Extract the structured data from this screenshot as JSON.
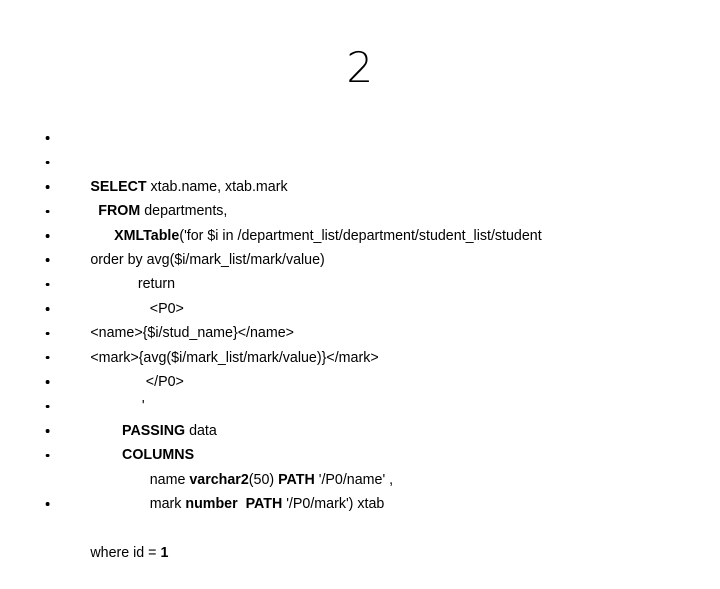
{
  "slide": {
    "title": "2",
    "background_color": "#ffffff",
    "text_color": "#000000",
    "bullet_glyph": "•"
  },
  "code_block": {
    "language": "Oracle SQL / XQuery",
    "lines": [
      {
        "text": "SELECT xtab.name, xtab.mark"
      },
      {
        "text": "  FROM departments,"
      },
      {
        "text": "      XMLTable('for $i in /department_list/department/student_list/student"
      },
      {
        "text": "order by avg($i/mark_list/mark/value)"
      },
      {
        "text": "            return"
      },
      {
        "text": "               <P0>"
      },
      {
        "text": "<name>{$i/stud_name}</name>"
      },
      {
        "text": "<mark>{avg($i/mark_list/mark/value)}</mark>"
      },
      {
        "text": "              </P0>"
      },
      {
        "text": "             '"
      },
      {
        "text": "        PASSING data"
      },
      {
        "text": "        COLUMNS"
      },
      {
        "text": "               name varchar2(50) PATH '/P0/name' ,"
      },
      {
        "text": "               mark number  PATH '/P0/mark') xtab"
      }
    ],
    "trailing_line": {
      "text": "where id = 1"
    }
  }
}
